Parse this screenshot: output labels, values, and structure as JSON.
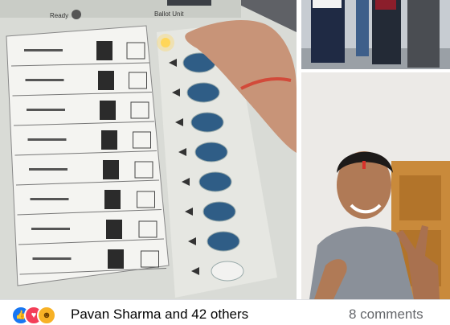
{
  "evm": {
    "ready_label": "Ready",
    "ballot_unit_label": "Ballot Unit"
  },
  "footer": {
    "reactions": [
      "like-icon",
      "love-icon",
      "haha-icon"
    ],
    "reaction_names": "Pavan Sharma and 42 others",
    "comments": "8 comments"
  },
  "colors": {
    "evm_blue": "#2f5d86",
    "like_blue": "#1877f2",
    "love_red": "#f33e58",
    "haha_yellow": "#f7b125"
  }
}
